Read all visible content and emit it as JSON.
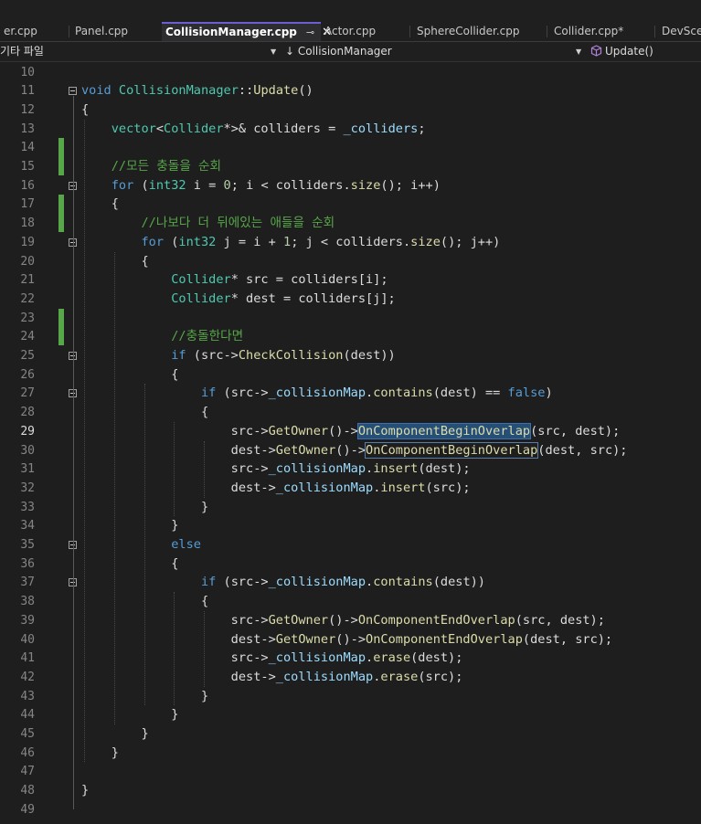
{
  "tabs": [
    {
      "label": "er.cpp"
    },
    {
      "label": "Panel.cpp"
    },
    {
      "label": "CollisionManager.cpp",
      "active": true,
      "pin": "⊸",
      "close": "✕"
    },
    {
      "label": "Actor.cpp"
    },
    {
      "label": "SphereCollider.cpp"
    },
    {
      "label": "Collider.cpp*"
    },
    {
      "label": "DevScer"
    }
  ],
  "nav": {
    "project": "기타 파일",
    "scope": "↓ CollisionManager",
    "member_icon": "cube-method-icon",
    "member": "Update()"
  },
  "colors": {
    "keyword": "#569cd6",
    "type": "#4ec9b0",
    "function": "#dcdcaa",
    "variable": "#9cdcfe",
    "number": "#b5cea8",
    "comment": "#57a64a",
    "plain": "#dcdcdc",
    "change_marker": "#57a64a",
    "tab_accent": "#6c5fd3"
  },
  "editor": {
    "current_line": 29,
    "lines": [
      {
        "n": "10",
        "tokens": []
      },
      {
        "n": "11",
        "tokens": [
          {
            "t": "void",
            "c": "kw"
          },
          {
            "t": " CollisionManager",
            "c": "typ"
          },
          {
            "t": "::",
            "c": "plain"
          },
          {
            "t": "Update",
            "c": "fn"
          },
          {
            "t": "()",
            "c": "plain"
          }
        ]
      },
      {
        "n": "12",
        "tokens": [
          {
            "t": "{",
            "c": "plain"
          }
        ]
      },
      {
        "n": "13",
        "tokens": [
          {
            "t": "    vector",
            "c": "typ"
          },
          {
            "t": "<",
            "c": "plain"
          },
          {
            "t": "Collider",
            "c": "typ"
          },
          {
            "t": "*>& colliders = ",
            "c": "plain"
          },
          {
            "t": "_colliders",
            "c": "var"
          },
          {
            "t": ";",
            "c": "plain"
          }
        ]
      },
      {
        "n": "14",
        "tokens": []
      },
      {
        "n": "15",
        "tokens": [
          {
            "t": "    //모든 충돌을 순회",
            "c": "cm"
          }
        ]
      },
      {
        "n": "16",
        "tokens": [
          {
            "t": "    for",
            "c": "kw"
          },
          {
            "t": " (",
            "c": "plain"
          },
          {
            "t": "int32",
            "c": "typ"
          },
          {
            "t": " i = ",
            "c": "plain"
          },
          {
            "t": "0",
            "c": "num"
          },
          {
            "t": "; i < colliders.",
            "c": "plain"
          },
          {
            "t": "size",
            "c": "fn"
          },
          {
            "t": "(); i++)",
            "c": "plain"
          }
        ]
      },
      {
        "n": "17",
        "tokens": [
          {
            "t": "    {",
            "c": "plain"
          }
        ]
      },
      {
        "n": "18",
        "tokens": [
          {
            "t": "        //나보다 더 뒤에있는 애들을 순회",
            "c": "cm"
          }
        ]
      },
      {
        "n": "19",
        "tokens": [
          {
            "t": "        for",
            "c": "kw"
          },
          {
            "t": " (",
            "c": "plain"
          },
          {
            "t": "int32",
            "c": "typ"
          },
          {
            "t": " j = i + ",
            "c": "plain"
          },
          {
            "t": "1",
            "c": "num"
          },
          {
            "t": "; j < colliders.",
            "c": "plain"
          },
          {
            "t": "size",
            "c": "fn"
          },
          {
            "t": "(); j++)",
            "c": "plain"
          }
        ]
      },
      {
        "n": "20",
        "tokens": [
          {
            "t": "        {",
            "c": "plain"
          }
        ]
      },
      {
        "n": "21",
        "tokens": [
          {
            "t": "            Collider",
            "c": "typ"
          },
          {
            "t": "* src = colliders[i];",
            "c": "plain"
          }
        ]
      },
      {
        "n": "22",
        "tokens": [
          {
            "t": "            Collider",
            "c": "typ"
          },
          {
            "t": "* dest = colliders[j];",
            "c": "plain"
          }
        ]
      },
      {
        "n": "23",
        "tokens": []
      },
      {
        "n": "24",
        "tokens": [
          {
            "t": "            //충돌한다면",
            "c": "cm"
          }
        ]
      },
      {
        "n": "25",
        "tokens": [
          {
            "t": "            if",
            "c": "kw"
          },
          {
            "t": " (src->",
            "c": "plain"
          },
          {
            "t": "CheckCollision",
            "c": "fn"
          },
          {
            "t": "(dest))",
            "c": "plain"
          }
        ]
      },
      {
        "n": "26",
        "tokens": [
          {
            "t": "            {",
            "c": "plain"
          }
        ]
      },
      {
        "n": "27",
        "tokens": [
          {
            "t": "                if",
            "c": "kw"
          },
          {
            "t": " (src->",
            "c": "plain"
          },
          {
            "t": "_collisionMap",
            "c": "var"
          },
          {
            "t": ".",
            "c": "plain"
          },
          {
            "t": "contains",
            "c": "fn"
          },
          {
            "t": "(dest) == ",
            "c": "plain"
          },
          {
            "t": "false",
            "c": "kw"
          },
          {
            "t": ")",
            "c": "plain"
          }
        ]
      },
      {
        "n": "28",
        "tokens": [
          {
            "t": "                {",
            "c": "plain"
          }
        ]
      },
      {
        "n": "29",
        "tokens": [
          {
            "t": "                    src->",
            "c": "plain"
          },
          {
            "t": "GetOwner",
            "c": "fn"
          },
          {
            "t": "()->",
            "c": "plain"
          },
          {
            "t": "OnComponentBeginOverlap",
            "c": "fn hl"
          },
          {
            "t": "(src, dest);",
            "c": "plain"
          }
        ]
      },
      {
        "n": "30",
        "tokens": [
          {
            "t": "                    dest->",
            "c": "plain"
          },
          {
            "t": "GetOwner",
            "c": "fn"
          },
          {
            "t": "()->",
            "c": "plain"
          },
          {
            "t": "OnComponentBeginOverlap",
            "c": "fn hl2"
          },
          {
            "t": "(dest, src);",
            "c": "plain"
          }
        ]
      },
      {
        "n": "31",
        "tokens": [
          {
            "t": "                    src->",
            "c": "plain"
          },
          {
            "t": "_collisionMap",
            "c": "var"
          },
          {
            "t": ".",
            "c": "plain"
          },
          {
            "t": "insert",
            "c": "fn"
          },
          {
            "t": "(dest);",
            "c": "plain"
          }
        ]
      },
      {
        "n": "32",
        "tokens": [
          {
            "t": "                    dest->",
            "c": "plain"
          },
          {
            "t": "_collisionMap",
            "c": "var"
          },
          {
            "t": ".",
            "c": "plain"
          },
          {
            "t": "insert",
            "c": "fn"
          },
          {
            "t": "(src);",
            "c": "plain"
          }
        ]
      },
      {
        "n": "33",
        "tokens": [
          {
            "t": "                }",
            "c": "plain"
          }
        ]
      },
      {
        "n": "34",
        "tokens": [
          {
            "t": "            }",
            "c": "plain"
          }
        ]
      },
      {
        "n": "35",
        "tokens": [
          {
            "t": "            else",
            "c": "kw"
          }
        ]
      },
      {
        "n": "36",
        "tokens": [
          {
            "t": "            {",
            "c": "plain"
          }
        ]
      },
      {
        "n": "37",
        "tokens": [
          {
            "t": "                if",
            "c": "kw"
          },
          {
            "t": " (src->",
            "c": "plain"
          },
          {
            "t": "_collisionMap",
            "c": "var"
          },
          {
            "t": ".",
            "c": "plain"
          },
          {
            "t": "contains",
            "c": "fn"
          },
          {
            "t": "(dest))",
            "c": "plain"
          }
        ]
      },
      {
        "n": "38",
        "tokens": [
          {
            "t": "                {",
            "c": "plain"
          }
        ]
      },
      {
        "n": "39",
        "tokens": [
          {
            "t": "                    src->",
            "c": "plain"
          },
          {
            "t": "GetOwner",
            "c": "fn"
          },
          {
            "t": "()->",
            "c": "plain"
          },
          {
            "t": "OnComponentEndOverlap",
            "c": "fn"
          },
          {
            "t": "(src, dest);",
            "c": "plain"
          }
        ]
      },
      {
        "n": "40",
        "tokens": [
          {
            "t": "                    dest->",
            "c": "plain"
          },
          {
            "t": "GetOwner",
            "c": "fn"
          },
          {
            "t": "()->",
            "c": "plain"
          },
          {
            "t": "OnComponentEndOverlap",
            "c": "fn"
          },
          {
            "t": "(dest, src);",
            "c": "plain"
          }
        ]
      },
      {
        "n": "41",
        "tokens": [
          {
            "t": "                    src->",
            "c": "plain"
          },
          {
            "t": "_collisionMap",
            "c": "var"
          },
          {
            "t": ".",
            "c": "plain"
          },
          {
            "t": "erase",
            "c": "fn"
          },
          {
            "t": "(dest);",
            "c": "plain"
          }
        ]
      },
      {
        "n": "42",
        "tokens": [
          {
            "t": "                    dest->",
            "c": "plain"
          },
          {
            "t": "_collisionMap",
            "c": "var"
          },
          {
            "t": ".",
            "c": "plain"
          },
          {
            "t": "erase",
            "c": "fn"
          },
          {
            "t": "(src);",
            "c": "plain"
          }
        ]
      },
      {
        "n": "43",
        "tokens": [
          {
            "t": "                }",
            "c": "plain"
          }
        ]
      },
      {
        "n": "44",
        "tokens": [
          {
            "t": "            }",
            "c": "plain"
          }
        ]
      },
      {
        "n": "45",
        "tokens": [
          {
            "t": "        }",
            "c": "plain"
          }
        ]
      },
      {
        "n": "46",
        "tokens": [
          {
            "t": "    }",
            "c": "plain"
          }
        ]
      },
      {
        "n": "47",
        "tokens": []
      },
      {
        "n": "48",
        "tokens": [
          {
            "t": "}",
            "c": "plain"
          }
        ]
      },
      {
        "n": "49",
        "tokens": []
      }
    ]
  }
}
